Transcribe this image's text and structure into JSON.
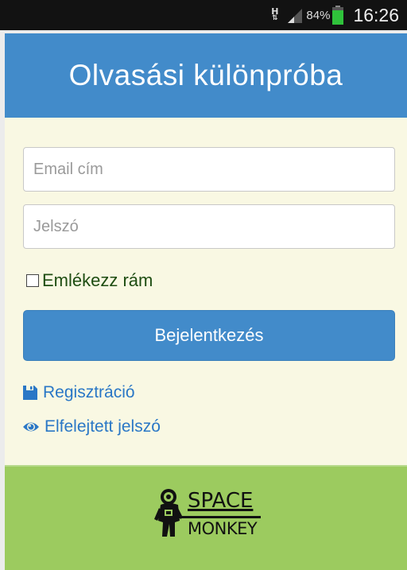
{
  "status_bar": {
    "network": "H",
    "battery_percent": "84%",
    "battery_level": 0.84,
    "time": "16:26"
  },
  "header": {
    "title": "Olvasási különpróba",
    "color": "#428bca"
  },
  "form": {
    "email_placeholder": "Email cím",
    "email_value": "",
    "password_placeholder": "Jelszó",
    "password_value": "",
    "remember_label": "Emlékezz rám",
    "remember_checked": false,
    "login_label": "Bejelentkezés"
  },
  "links": {
    "register": {
      "label": "Regisztráció",
      "icon": "floppy-disk-icon"
    },
    "forgot": {
      "label": "Elfelejtett jelszó",
      "icon": "eye-icon"
    }
  },
  "footer": {
    "logo_line1": "SPACE",
    "logo_line2": "MONKEY",
    "color": "#9ccb5f"
  }
}
